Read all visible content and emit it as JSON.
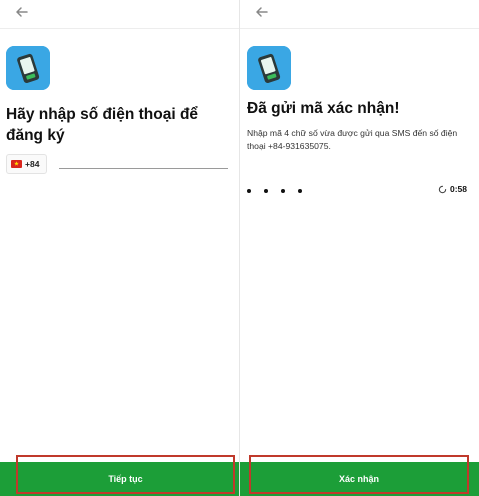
{
  "left_screen": {
    "title": "Hãy nhập số điện thoại để đăng ký",
    "country_code": "+84",
    "phone_value": "",
    "continue_button": "Tiếp tục"
  },
  "right_screen": {
    "title": "Đã gửi mã xác nhận!",
    "description": "Nhập mã 4 chữ số vừa được gửi qua SMS đến số điện thoại +84-931635075.",
    "otp_dots": [
      "•",
      "•",
      "•",
      "•"
    ],
    "timer": "0:58",
    "confirm_button": "Xác nhận"
  },
  "icons": {
    "back": "back-arrow-icon",
    "app": "phone-app-icon",
    "flag": "vietnam-flag-icon",
    "timer": "timer-icon"
  },
  "colors": {
    "accent_green": "#1c9e38",
    "app_icon_blue": "#3aa7e4",
    "highlight_red": "#c0392b"
  }
}
